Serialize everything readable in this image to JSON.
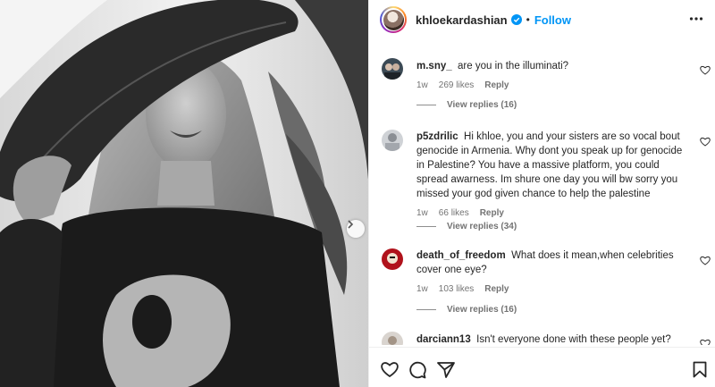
{
  "post": {
    "username": "khloekardashian",
    "separator": "•",
    "follow_label": "Follow"
  },
  "comments": [
    {
      "user": "m.sny_",
      "text": "are you in the illuminati?",
      "age": "1w",
      "likes": "269 likes",
      "reply_label": "Reply",
      "view_replies": "View replies (16)"
    },
    {
      "user": "p5zdrilic",
      "text": "Hi khloe, you and your sisters are so vocal bout genocide in Armenia. Why dont you speak up for genocide in Palestine? You have a massive platform, you could spread awarness. Im shure one day you will bw sorry you missed your god given chance to help the palestine",
      "age": "1w",
      "likes": "66 likes",
      "reply_label": "Reply",
      "view_replies": "View replies (34)"
    },
    {
      "user": "death_of_freedom",
      "text": "What does it mean,when celebrities cover one eye?",
      "age": "1w",
      "likes": "103 likes",
      "reply_label": "Reply",
      "view_replies": "View replies (16)"
    },
    {
      "user": "darciann13",
      "text": "Isn't everyone done with these people yet?"
    }
  ],
  "icons": {
    "verified": "verified-badge-icon",
    "more": "more-options-icon",
    "heart": "heart-icon",
    "like": "heart-icon",
    "comment": "comment-icon",
    "share": "share-icon",
    "save": "bookmark-icon",
    "carousel": "chevron-right-icon"
  },
  "colors": {
    "accent": "#0095f6",
    "text": "#262626",
    "muted": "#737373"
  }
}
